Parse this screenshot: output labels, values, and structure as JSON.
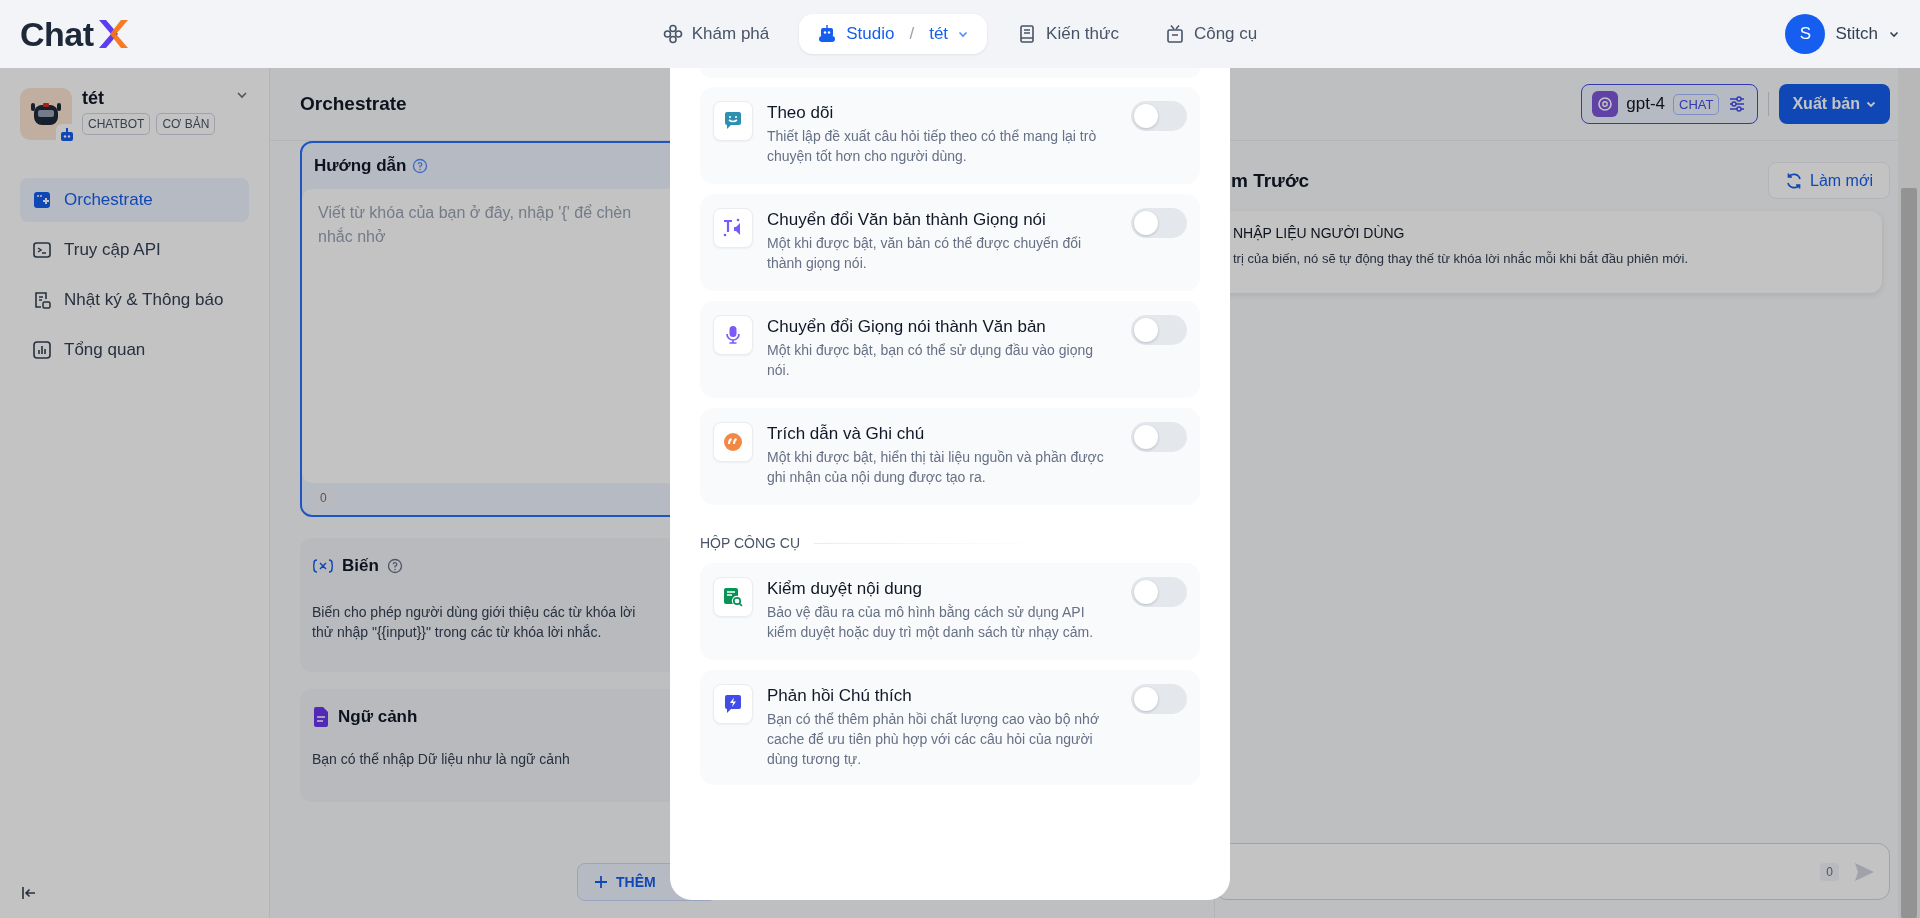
{
  "header": {
    "logo": "Chat",
    "nav": [
      {
        "label": "Khám phá",
        "selected": false
      },
      {
        "label": "Studio",
        "selected": true,
        "separator": "/",
        "app": "tét"
      },
      {
        "label": "Kiến thức",
        "selected": false
      },
      {
        "label": "Công cụ",
        "selected": false
      }
    ],
    "user": {
      "initial": "S",
      "name": "Stitch"
    }
  },
  "sidebar": {
    "app": {
      "name": "tét",
      "badges": [
        "CHATBOT",
        "CƠ BẢN"
      ]
    },
    "items": [
      {
        "label": "Orchestrate",
        "selected": true
      },
      {
        "label": "Truy cập API",
        "selected": false
      },
      {
        "label": "Nhật ký & Thông báo",
        "selected": false
      },
      {
        "label": "Tổng quan",
        "selected": false
      }
    ]
  },
  "main": {
    "title": "Orchestrate",
    "model": {
      "name": "gpt-4",
      "badge": "CHAT"
    },
    "publish": "Xuất bản",
    "instructions": {
      "title": "Hướng dẫn",
      "placeholder": "Viết từ khóa của bạn ở đây, nhập '{' để chèn\nnhắc nhở",
      "count": "0"
    },
    "variables": {
      "title": "Biến",
      "description": "Biến cho phép người dùng giới thiệu các từ khóa lời\nthử nhập \"{{input}}\" trong các từ khóa lời nhắc."
    },
    "context": {
      "title": "Ngữ cảnh",
      "description": "Bạn có thể nhập Dữ liệu như là ngữ cảnh"
    },
    "add_button": "THÊM"
  },
  "preview": {
    "title": "m Trước",
    "refresh": "Làm mới",
    "input_card": {
      "title": "NHẬP LIỆU NGƯỜI DÙNG",
      "description": "trị của biến, nó sẽ tự động thay thế từ khóa lời nhắc mỗi khi bắt đầu phiên mới."
    },
    "count": "0"
  },
  "modal": {
    "features": [
      {
        "title": "Theo dõi",
        "description": "Thiết lập đề xuất câu hỏi tiếp theo có thể mang lại trò chuyện tốt hơn cho người dùng.",
        "on": false
      },
      {
        "title": "Chuyển đổi Văn bản thành Giọng nói",
        "description": "Một khi được bật, văn bản có thể được chuyển đổi thành giọng nói.",
        "on": false
      },
      {
        "title": "Chuyển đổi Giọng nói thành Văn bản",
        "description": "Một khi được bật, bạn có thể sử dụng đầu vào giọng nói.",
        "on": false
      },
      {
        "title": "Trích dẫn và Ghi chú",
        "description": "Một khi được bật, hiển thị tài liệu nguồn và phần được ghi nhận của nội dung được tạo ra.",
        "on": false
      }
    ],
    "toolbox": {
      "title": "HỘP CÔNG CỤ",
      "items": [
        {
          "title": "Kiểm duyệt nội dung",
          "description": "Bảo vệ đầu ra của mô hình bằng cách sử dụng API kiểm duyệt hoặc duy trì một danh sách từ nhạy cảm.",
          "on": false
        },
        {
          "title": "Phản hồi Chú thích",
          "description": "Bạn có thể thêm phản hồi chất lượng cao vào bộ nhớ cache để ưu tiên phù hợp với các câu hỏi của người dùng tương tự.",
          "on": false
        }
      ]
    }
  }
}
